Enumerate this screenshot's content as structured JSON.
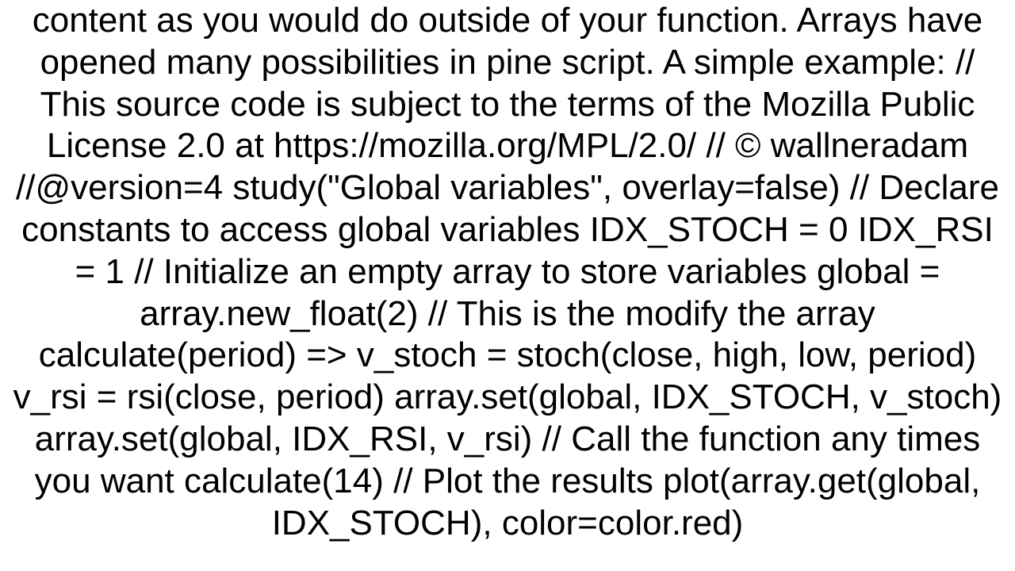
{
  "document": {
    "body_text": "content as you would do outside of your function. Arrays have opened many possibilities in pine script. A simple example: // This source code is subject to the terms of the Mozilla Public License 2.0 at https://mozilla.org/MPL/2.0/ // © wallneradam //@version=4 study(\"Global variables\", overlay=false)  // Declare constants to access global variables IDX_STOCH = 0 IDX_RSI = 1  // Initialize an empty array to store variables global = array.new_float(2)  // This is the modify the array calculate(period) =>     v_stoch = stoch(close, high, low, period)     v_rsi = rsi(close, period)     array.set(global, IDX_STOCH, v_stoch)     array.set(global, IDX_RSI, v_rsi)       // Call the function any times you want calculate(14) // Plot the results plot(array.get(global, IDX_STOCH), color=color.red)"
  }
}
